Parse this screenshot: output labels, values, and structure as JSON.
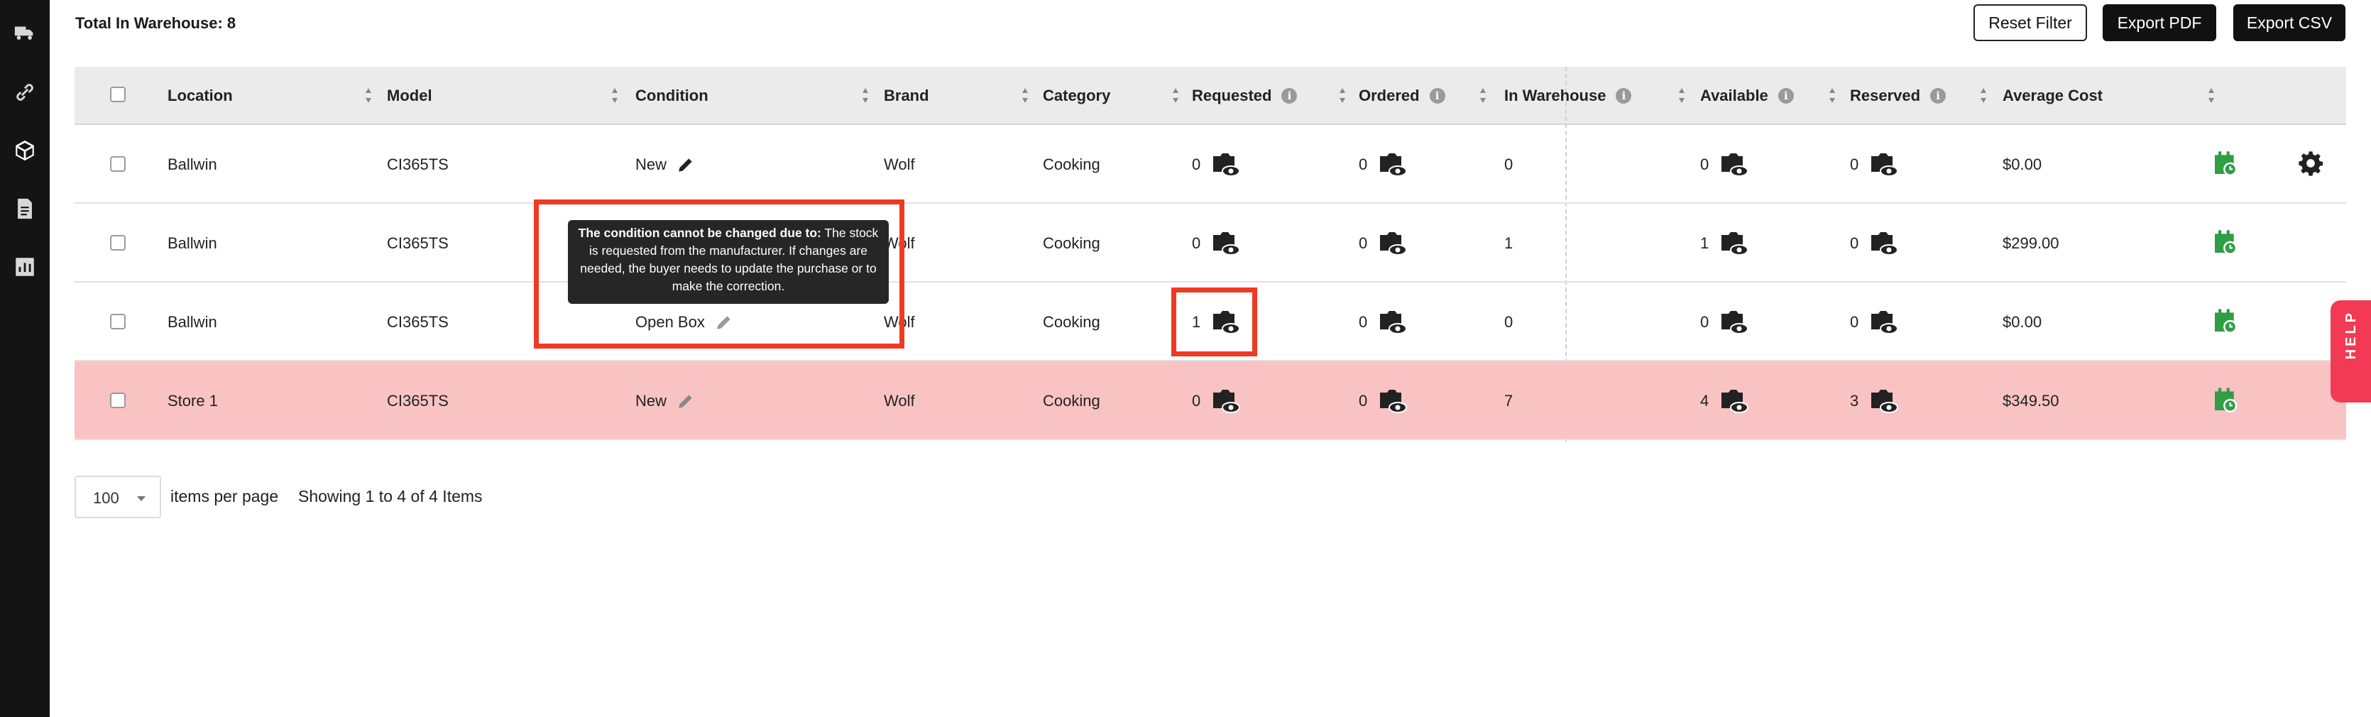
{
  "header": {
    "total_label": "Total In Warehouse: 8",
    "reset_filter": "Reset Filter",
    "export_pdf": "Export PDF",
    "export_csv": "Export CSV"
  },
  "nav": {
    "icons": [
      "truck-icon",
      "link-icon",
      "box-icon",
      "document-icon",
      "chart-icon"
    ],
    "active": "box-icon"
  },
  "table": {
    "columns": {
      "location": "Location",
      "model": "Model",
      "condition": "Condition",
      "brand": "Brand",
      "category": "Category",
      "requested": "Requested",
      "ordered": "Ordered",
      "in_warehouse": "In Warehouse",
      "available": "Available",
      "reserved": "Reserved",
      "average_cost": "Average Cost"
    },
    "rows": [
      {
        "location": "Ballwin",
        "model": "CI365TS",
        "condition": "New",
        "brand": "Wolf",
        "category": "Cooking",
        "requested": "0",
        "ordered": "0",
        "in_warehouse": "0",
        "available": "0",
        "reserved": "0",
        "average_cost": "$0.00"
      },
      {
        "location": "Ballwin",
        "model": "CI365TS",
        "condition": "",
        "brand": "Wolf",
        "category": "Cooking",
        "requested": "0",
        "ordered": "0",
        "in_warehouse": "1",
        "available": "1",
        "reserved": "0",
        "average_cost": "$299.00"
      },
      {
        "location": "Ballwin",
        "model": "CI365TS",
        "condition": "Open Box",
        "brand": "Wolf",
        "category": "Cooking",
        "requested": "1",
        "ordered": "0",
        "in_warehouse": "0",
        "available": "0",
        "reserved": "0",
        "average_cost": "$0.00"
      },
      {
        "location": "Store 1",
        "model": "CI365TS",
        "condition": "New",
        "brand": "Wolf",
        "category": "Cooking",
        "requested": "0",
        "ordered": "0",
        "in_warehouse": "7",
        "available": "4",
        "reserved": "3",
        "average_cost": "$349.50"
      }
    ]
  },
  "tooltip": {
    "bold": "The condition cannot be changed due to:",
    "text": " The stock is requested from the manufacturer. If changes are needed, the buyer needs to update the purchase or to make the correction."
  },
  "pagination": {
    "per_page_value": "100",
    "per_page_label": "items per page",
    "showing": "Showing 1 to 4 of 4 Items"
  },
  "help": {
    "label": "HELP"
  },
  "colors": {
    "accent_green": "#2f9e44",
    "delete_red": "#e8332e",
    "row_alert": "#f9c3c3",
    "annotation_red": "#ee3a22",
    "help_pink": "#f23a55"
  }
}
